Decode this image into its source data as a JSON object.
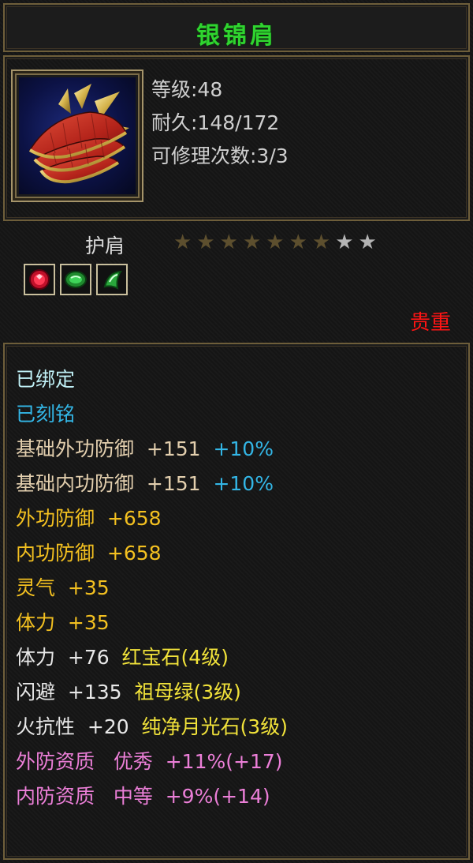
{
  "title": "银锦肩",
  "info": {
    "level": "等级:48",
    "durability": "耐久:148/172",
    "repairs": "可修理次数:3/3"
  },
  "item": {
    "type": "护肩",
    "stars_filled": 7,
    "stars_total": 9,
    "gems": [
      "ruby-gem-icon",
      "emerald-gem-icon",
      "moonstone-gem-icon"
    ],
    "rarity": "贵重"
  },
  "colors": {
    "title": "#2fd42f",
    "rarity": "#ff1414",
    "star_on": "#5d4f2e",
    "star_off": "#b4b4b4"
  },
  "attributes": [
    {
      "parts": [
        {
          "text": "已绑定",
          "cls": "c-cyan"
        }
      ]
    },
    {
      "parts": [
        {
          "text": "已刻铭",
          "cls": "c-blue"
        }
      ]
    },
    {
      "parts": [
        {
          "text": "基础外功防御  +151  ",
          "cls": "c-tan"
        },
        {
          "text": "+10%",
          "cls": "c-blue"
        }
      ]
    },
    {
      "parts": [
        {
          "text": "基础内功防御  +151  ",
          "cls": "c-tan"
        },
        {
          "text": "+10%",
          "cls": "c-blue"
        }
      ]
    },
    {
      "parts": [
        {
          "text": "外功防御  +658",
          "cls": "c-gold"
        }
      ]
    },
    {
      "parts": [
        {
          "text": "内功防御  +658",
          "cls": "c-gold"
        }
      ]
    },
    {
      "parts": [
        {
          "text": "灵气  +35",
          "cls": "c-gold"
        }
      ]
    },
    {
      "parts": [
        {
          "text": "体力  +35",
          "cls": "c-gold"
        }
      ]
    },
    {
      "parts": [
        {
          "text": "体力  +76  ",
          "cls": "c-white"
        },
        {
          "text": "红宝石(4级)",
          "cls": "c-yellow"
        }
      ]
    },
    {
      "parts": [
        {
          "text": "闪避  +135  ",
          "cls": "c-white"
        },
        {
          "text": "祖母绿(3级)",
          "cls": "c-yellow"
        }
      ]
    },
    {
      "parts": [
        {
          "text": "火抗性  +20  ",
          "cls": "c-white"
        },
        {
          "text": "纯净月光石(3级)",
          "cls": "c-yellow"
        }
      ]
    },
    {
      "parts": [
        {
          "text": "外防资质   优秀  +11%(+17)",
          "cls": "c-pink"
        }
      ]
    },
    {
      "parts": [
        {
          "text": "内防资质   中等  +9%(+14)",
          "cls": "c-pink"
        }
      ]
    }
  ]
}
